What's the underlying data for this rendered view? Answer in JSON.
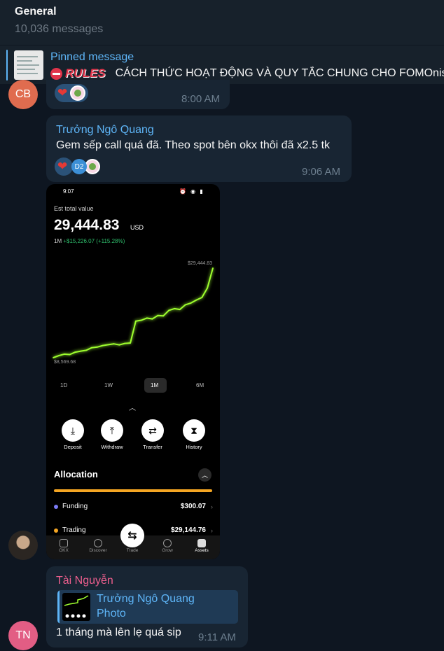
{
  "chat": {
    "title": "General",
    "subtitle": "10,036 messages"
  },
  "pinned": {
    "label": "Pinned message",
    "rules_tag": "RULES",
    "text": "CÁCH THỨC HOẠT ĐỘNG VÀ QUY TẮC CHUNG CHO FOMOnista"
  },
  "messages": [
    {
      "avatar_initials": "CB",
      "avatar_color": "#e06c4f",
      "time": "8:00 AM",
      "reactions": [
        "heart",
        "pepe-sticker"
      ]
    },
    {
      "sender": "Trưởng Ngô Quang",
      "sender_color": "#5eb5f7",
      "text": "Gem sếp call quá đã. Theo spot bên okx thôi đã x2.5 tk",
      "time": "9:06 AM",
      "reactions": [
        "heart",
        "D2",
        "pepe-sticker"
      ]
    },
    {
      "type": "photo",
      "photo": {
        "status_time": "9:07",
        "status_battery": "35",
        "label": "Est total value",
        "value": "29,444.83",
        "currency": "USD",
        "change_period": "1M",
        "change": "+$15,226.07 (+115.28%)",
        "chart_max_label": "$29,444.83",
        "chart_min_label": "$8,569.68",
        "ranges": [
          "1D",
          "1W",
          "1M",
          "6M"
        ],
        "active_range": "1M",
        "actions": [
          "Deposit",
          "Withdraw",
          "Transfer",
          "History"
        ],
        "allocation_title": "Allocation",
        "allocation": [
          {
            "label": "Funding",
            "value": "$300.07",
            "color": "#7b7bf5"
          },
          {
            "label": "Trading",
            "value": "$29,144.76",
            "color": "#f5a623"
          }
        ],
        "nav": [
          "OKX",
          "Discover",
          "Trade",
          "Grow",
          "Assets"
        ]
      }
    },
    {
      "avatar_initials": "TN",
      "avatar_color": "#e25d84",
      "sender": "Tài Nguyễn",
      "sender_color": "#ee5f8e",
      "reply_to": {
        "name": "Trưởng Ngô Quang",
        "kind": "Photo"
      },
      "text": "1 tháng mà lên lẹ quá sip",
      "time": "9:11 AM"
    }
  ],
  "chart_data": {
    "type": "line",
    "title": "",
    "xlabel": "",
    "ylabel": "",
    "ylim": [
      8569.68,
      29444.83
    ],
    "series": [
      {
        "color": "#9eff2f",
        "values": [
          8569.68,
          9050,
          9400,
          9300,
          9850,
          10100,
          10300,
          10900,
          11050,
          11400,
          11600,
          11800,
          11550,
          11900,
          12000,
          17100,
          17300,
          17800,
          17600,
          18400,
          18300,
          19600,
          20000,
          19800,
          20900,
          21300,
          22000,
          22600,
          24800,
          29444.83
        ]
      }
    ]
  }
}
